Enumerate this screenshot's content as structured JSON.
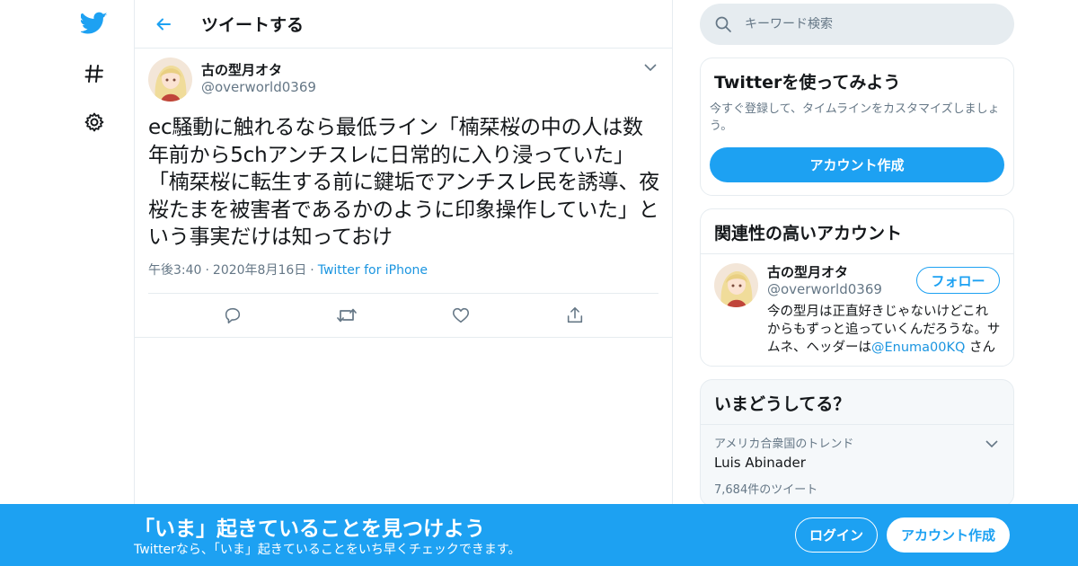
{
  "header": {
    "title": "ツイートする"
  },
  "nav": {
    "icons": [
      "twitter-bird-icon",
      "hashtag-icon",
      "gear-icon"
    ]
  },
  "tweet": {
    "author_name": "古の型月オタ",
    "author_handle": "@overworld0369",
    "text": "ec騒動に触れるなら最低ライン「楠栞桜の中の人は数年前から5chアンチスレに日常的に入り浸っていた」「楠栞桜に転生する前に鍵垢でアンチスレ民を誘導、夜桜たまを被害者であるかのように印象操作していた」という事実だけは知っておけ",
    "time": "午後3:40",
    "date": "2020年8月16日",
    "source": "Twitter for iPhone",
    "actions": [
      "reply-icon",
      "retweet-icon",
      "like-icon",
      "share-icon"
    ]
  },
  "search": {
    "placeholder": "キーワード検索"
  },
  "signup_card": {
    "title": "Twitterを使ってみよう",
    "description": "今すぐ登録して、タイムラインをカスタマイズしましょう。",
    "button": "アカウント作成"
  },
  "related": {
    "title": "関連性の高いアカウント",
    "account": {
      "name": "古の型月オタ",
      "handle": "@overworld0369",
      "follow_label": "フォロー",
      "bio_text": "今の型月は正直好きじゃないけどこれからもずっと追っていくんだろうな。サムネ、ヘッダーは",
      "bio_mention": "@Enuma00KQ",
      "bio_tail": " さん"
    }
  },
  "trends": {
    "title": "いまどうしてる？",
    "items": [
      {
        "context": "アメリカ合衆国のトレンド",
        "name": "Luis Abinader",
        "count": "7,684件のツイート"
      }
    ]
  },
  "bottom_bar": {
    "title": "「いま」起きていることを見つけよう",
    "subtitle": "Twitterなら、「いま」起きていることをいち早くチェックできます。",
    "login": "ログイン",
    "signup": "アカウント作成"
  },
  "colors": {
    "brand": "#1da1f2",
    "link": "#1b95e0",
    "muted": "#657786"
  }
}
